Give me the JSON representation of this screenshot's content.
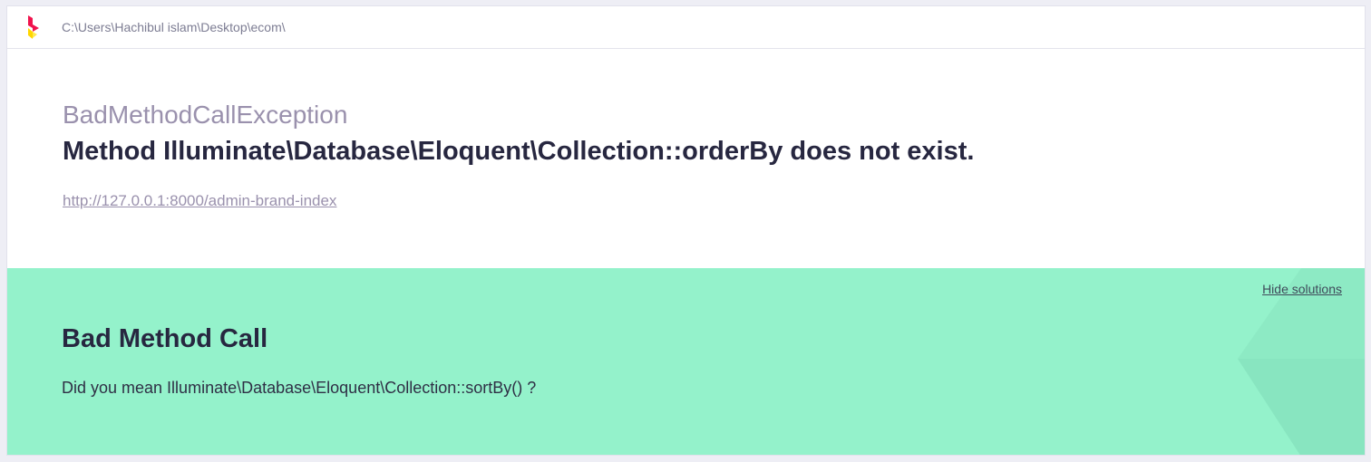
{
  "topbar": {
    "path": "C:\\Users\\Hachibul islam\\Desktop\\ecom\\"
  },
  "exception": {
    "class": "BadMethodCallException",
    "message": "Method Illuminate\\Database\\Eloquent\\Collection::orderBy does not exist.",
    "url": "http://127.0.0.1:8000/admin-brand-index"
  },
  "solution": {
    "hide_label": "Hide solutions",
    "title": "Bad Method Call",
    "description": "Did you mean Illuminate\\Database\\Eloquent\\Collection::sortBy() ?"
  },
  "colors": {
    "solution_bg": "#94f2cb",
    "title_text": "#272740",
    "muted_text": "#9a91ad",
    "logo_red": "#f0134d",
    "logo_yellow": "#ffd600"
  },
  "icons": {
    "logo": "ignition-logo-icon"
  }
}
